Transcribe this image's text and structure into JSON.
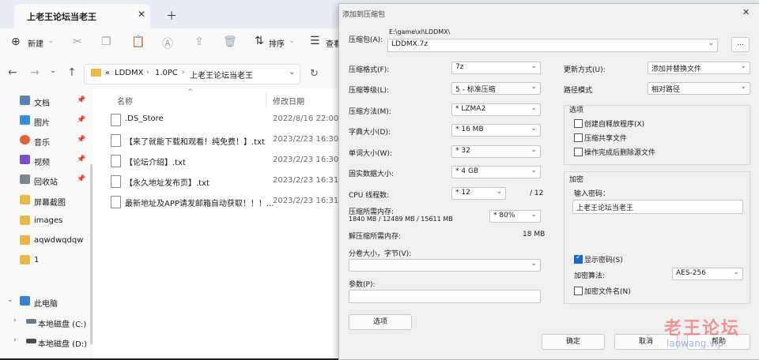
{
  "explorer": {
    "tab_title": "上老王论坛当老王",
    "toolbar": {
      "new_label": "新建",
      "sort_label": "排序",
      "view_label": "查看"
    },
    "address": {
      "path": [
        "«",
        "LDDMX",
        "1.0PC",
        "上老王论坛当老王"
      ]
    },
    "sidebar": {
      "pinned": [
        {
          "label": "文档",
          "icon": "document-icon",
          "color": "#5b7fb8"
        },
        {
          "label": "图片",
          "icon": "picture-icon",
          "color": "#3b8ed0"
        },
        {
          "label": "音乐",
          "icon": "music-icon",
          "color": "#e0643a"
        },
        {
          "label": "视频",
          "icon": "video-icon",
          "color": "#7a4fc8"
        },
        {
          "label": "回收站",
          "icon": "recycle-bin-icon",
          "color": "#7b8591"
        }
      ],
      "folders": [
        {
          "label": "屏幕截图",
          "icon": "folder-icon"
        },
        {
          "label": "images",
          "icon": "folder-icon"
        },
        {
          "label": "aqwdwqdqw",
          "icon": "folder-icon"
        },
        {
          "label": "1",
          "icon": "folder-icon"
        }
      ],
      "this_pc": "此电脑",
      "drives": [
        {
          "label": "本地磁盘 (C:)",
          "icon": "drive-icon"
        },
        {
          "label": "本地磁盘 (D:)",
          "icon": "drive-icon"
        }
      ]
    },
    "columns": {
      "name": "名称",
      "date": "修改日期"
    },
    "files": [
      {
        "name": ".DS_Store",
        "date": "2022/8/16 22:00"
      },
      {
        "name": "【来了就能下载和观看！纯免费！】.txt",
        "date": "2023/2/23 16:30"
      },
      {
        "name": "【论坛介绍】.txt",
        "date": "2023/2/23 16:30"
      },
      {
        "name": "【永久地址发布页】.txt",
        "date": "2023/2/23 16:31"
      },
      {
        "name": "最新地址及APP请发邮箱自动获取！！！...",
        "date": "2023/2/23 16:31"
      }
    ]
  },
  "dialog": {
    "title": "添加到压缩包",
    "archive_label": "压缩包(A):",
    "archive_dir": "E:\\game\\xl\\LDDMX\\",
    "archive_name": "LDDMX.7z",
    "browse_label": "...",
    "format_label": "压缩格式(F):",
    "format_value": "7z",
    "level_label": "压缩等级(L):",
    "level_value": "5 - 标准压缩",
    "method_label": "压缩方法(M):",
    "method_value": "* LZMA2",
    "dict_label": "字典大小(D):",
    "dict_value": "* 16 MB",
    "word_label": "单词大小(W):",
    "word_value": "* 32",
    "solid_label": "固实数据大小:",
    "solid_value": "* 4 GB",
    "threads_label": "CPU 线程数:",
    "threads_value": "* 12",
    "threads_total": "/ 12",
    "mem_comp_label": "压缩所需内存:",
    "mem_comp_detail": "1840 MB / 12489 MB / 15611 MB",
    "mem_percent": "* 80%",
    "mem_decomp_label": "解压缩所需内存:",
    "mem_decomp_value": "18 MB",
    "split_label": "分卷大小，字节(V):",
    "params_label": "参数(P):",
    "options_btn": "选项",
    "update_label": "更新方式(U):",
    "update_value": "添加并替换文件",
    "path_mode_label": "路径模式",
    "path_mode_value": "相对路径",
    "options_group": "选项",
    "opt_sfx": "创建自释放程序(X)",
    "opt_shared": "压缩共享文件",
    "opt_delete": "操作完成后删除源文件",
    "encrypt_group": "加密",
    "password_label": "输入密码：",
    "password_value": "上老王论坛当老王",
    "show_password": "显示密码(S)",
    "enc_method_label": "加密算法:",
    "enc_method_value": "AES-256",
    "encrypt_names": "加密文件名(N)",
    "ok": "确定",
    "cancel": "取消",
    "help": "帮助",
    "close_glyph": "✕"
  },
  "watermark": {
    "line1": "老王论坛",
    "line2": "laowang.vip"
  }
}
